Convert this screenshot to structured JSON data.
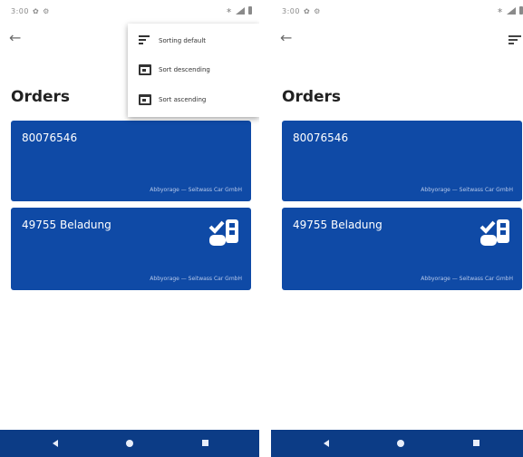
{
  "status_bar": {
    "time": "3:00",
    "left_icons": [
      "notification-icon",
      "settings-icon"
    ],
    "right_icons": [
      "signal-icon",
      "wifi-icon",
      "battery-icon"
    ]
  },
  "screen": {
    "title": "Orders",
    "orders": [
      {
        "number": "80076546",
        "subtitle": "Abbyorage — Seitwass Car GmbH",
        "has_icon": false
      },
      {
        "number": "49755 Beladung",
        "subtitle": "Abbyorage — Seitwass Car GmbH",
        "has_icon": true,
        "icon": "checked-mail-icon"
      }
    ]
  },
  "sort_menu": {
    "items": [
      {
        "label": "Sorting default",
        "icon": "sort-lines-icon"
      },
      {
        "label": "Sort descending",
        "icon": "calendar-descending-icon"
      },
      {
        "label": "Sort ascending",
        "icon": "calendar-ascending-icon"
      }
    ]
  },
  "nav_bar": {
    "color": "#0c3c86",
    "buttons": [
      "back-button",
      "home-button",
      "recents-button"
    ]
  },
  "colors": {
    "card_background": "#0f4aa6",
    "nav_background": "#0c3c86"
  }
}
